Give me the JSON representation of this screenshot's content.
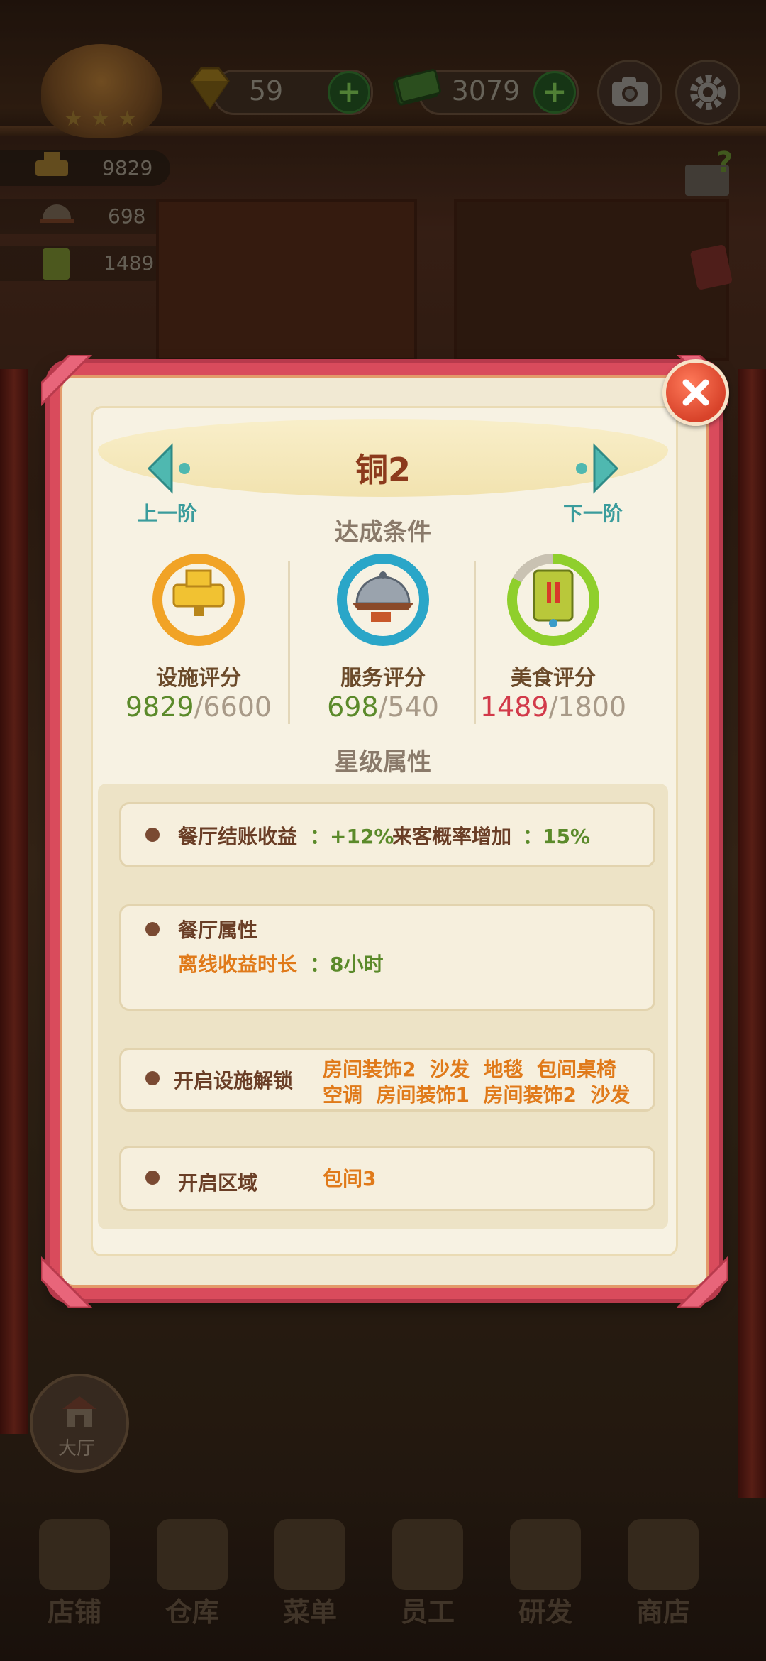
{
  "top_bar": {
    "gems": "59",
    "cash": "3079"
  },
  "side_stats": {
    "facility": "9829",
    "service": "698",
    "food": "1489"
  },
  "hall_button": {
    "label": "大厅"
  },
  "dock": {
    "items": [
      {
        "label": "店铺",
        "icon": "shop-icon"
      },
      {
        "label": "仓库",
        "icon": "warehouse-icon"
      },
      {
        "label": "菜单",
        "icon": "menu-clipboard-icon"
      },
      {
        "label": "员工",
        "icon": "staff-icon"
      },
      {
        "label": "研发",
        "icon": "wok-icon"
      },
      {
        "label": "商店",
        "icon": "store-icon"
      }
    ]
  },
  "modal": {
    "title": "铜2",
    "prev_label": "上一阶",
    "next_label": "下一阶",
    "conditions_heading": "达成条件",
    "scores": [
      {
        "name": "设施评分",
        "current": "9829",
        "target": "/6600",
        "progress": 1.0,
        "ring_color": "#f1a326",
        "current_color": "#5b8a2a",
        "icon": "golden-wok-icon"
      },
      {
        "name": "服务评分",
        "current": "698",
        "target": "/540",
        "progress": 1.0,
        "ring_color": "#2aa6c8",
        "current_color": "#5b8a2a",
        "icon": "serving-tray-icon"
      },
      {
        "name": "美食评分",
        "current": "1489",
        "target": "/1800",
        "progress": 0.83,
        "ring_color": "#8fcf2c",
        "current_color": "#d23a4a",
        "icon": "recipe-book-icon"
      }
    ],
    "attributes_heading": "星级属性",
    "rows": {
      "income": {
        "label": "餐厅结账收益",
        "value": "：+12%",
        "label2": "来客概率增加",
        "value2": "：15%"
      },
      "restaurant_attr": {
        "label": "餐厅属性",
        "sub_label": "离线收益时长",
        "sub_value": "：8小时"
      },
      "unlock": {
        "label": "开启设施解锁",
        "line1": "房间装饰2  沙发  地毯  包间桌椅",
        "line2": "空调  房间装饰1  房间装饰2  沙发"
      },
      "area": {
        "label": "开启区域",
        "value": "包间3"
      }
    }
  },
  "colors": {
    "frame": "#d94b5c",
    "paper": "#f7f2e3",
    "accent_teal": "#3a9c9c",
    "orange_text": "#e07a1a",
    "green_text": "#5b8a2a"
  }
}
